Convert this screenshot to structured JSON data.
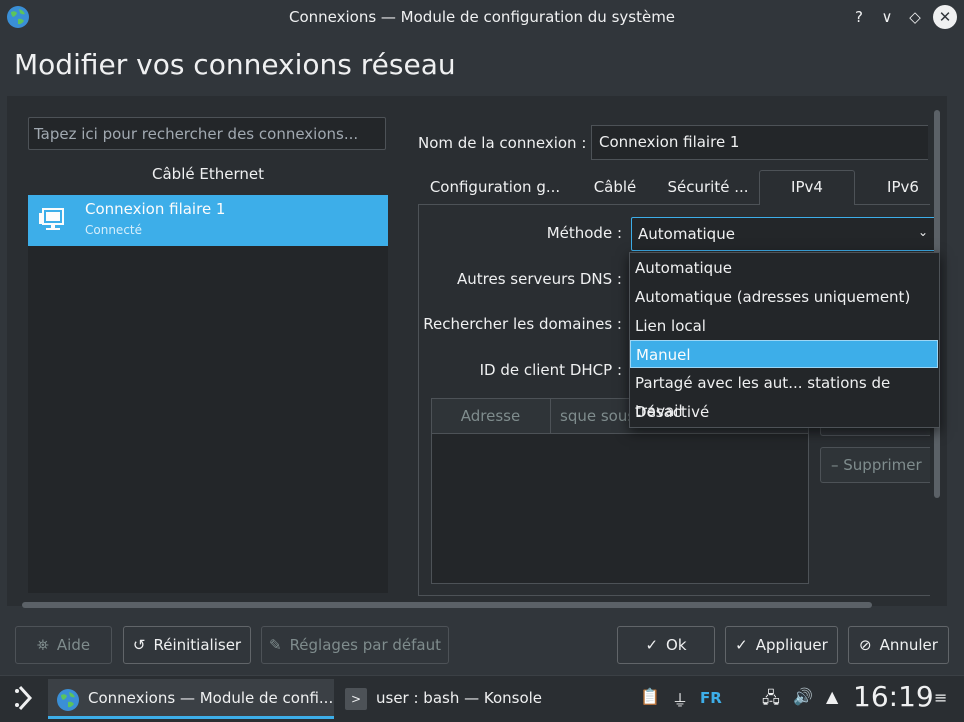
{
  "window": {
    "title": "Connexions — Module de configuration du système",
    "help": "?",
    "minimize": "∨",
    "maximize": "◇",
    "close": "✕"
  },
  "page_title": "Modifier vos connexions réseau",
  "connections": {
    "search_placeholder": "Tapez ici pour rechercher des connexions...",
    "section": "Câblé Ethernet",
    "items": [
      {
        "name": "Connexion filaire 1",
        "status": "Connecté"
      }
    ]
  },
  "editor": {
    "name_label": "Nom de la connexion :",
    "name_value": "Connexion filaire 1",
    "tabs": [
      {
        "label": "Configuration g..."
      },
      {
        "label": "Câblé"
      },
      {
        "label": "Sécurité ..."
      },
      {
        "label": "IPv4"
      },
      {
        "label": "IPv6"
      }
    ],
    "active_tab": "IPv4",
    "fields": {
      "method_label": "Méthode :",
      "method_value": "Automatique",
      "dns_label": "Autres serveurs DNS :",
      "domains_label": "Rechercher les domaines :",
      "dhcp_label": "ID de client DHCP :"
    },
    "table": {
      "columns": [
        "Adresse",
        "sque sous"
      ]
    },
    "remove_label": "Supprimer"
  },
  "dropdown": {
    "options": [
      "Automatique",
      "Automatique (adresses uniquement)",
      "Lien local",
      "Manuel",
      "Partagé avec les aut... stations de travail",
      "Désactivé"
    ],
    "highlighted": "Manuel"
  },
  "buttons": {
    "help": "Aide",
    "reset": "Réinitialiser",
    "defaults": "Réglages par défaut",
    "ok": "Ok",
    "apply": "Appliquer",
    "cancel": "Annuler"
  },
  "taskbar": {
    "task1": "Connexions — Module de confi...",
    "task2": "user : bash — Konsole",
    "lang": "FR",
    "clock": "16:19"
  },
  "colors": {
    "accent": "#3daee9",
    "window_bg": "#31363b",
    "view_bg": "#232629"
  }
}
